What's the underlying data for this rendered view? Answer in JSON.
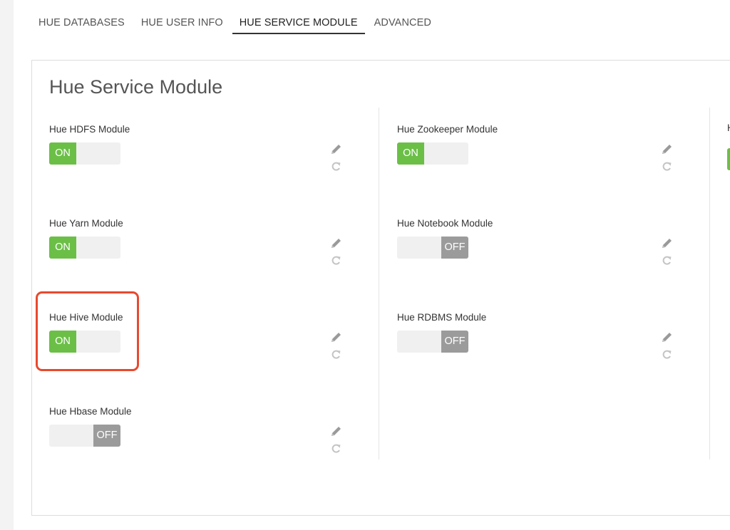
{
  "tabs": [
    {
      "label": "HUE DATABASES",
      "active": false
    },
    {
      "label": "HUE USER INFO",
      "active": false
    },
    {
      "label": "HUE SERVICE MODULE",
      "active": true
    },
    {
      "label": "ADVANCED",
      "active": false
    }
  ],
  "panel": {
    "title": "Hue Service Module"
  },
  "modules": [
    {
      "label": "Hue HDFS Module",
      "state": "ON"
    },
    {
      "label": "Hue Yarn Module",
      "state": "ON"
    },
    {
      "label": "Hue Hive Module",
      "state": "ON"
    },
    {
      "label": "Hue Hbase Module",
      "state": "OFF"
    },
    {
      "label": "Hue Zookeeper Module",
      "state": "ON"
    },
    {
      "label": "Hue Notebook Module",
      "state": "OFF"
    },
    {
      "label": "Hue RDBMS Module",
      "state": "OFF"
    }
  ],
  "icons": {
    "edit": "pencil-icon",
    "reset": "refresh-icon"
  },
  "colors": {
    "on": "#6bbf47",
    "off": "#9b9b9b",
    "highlight": "#e8492e"
  }
}
